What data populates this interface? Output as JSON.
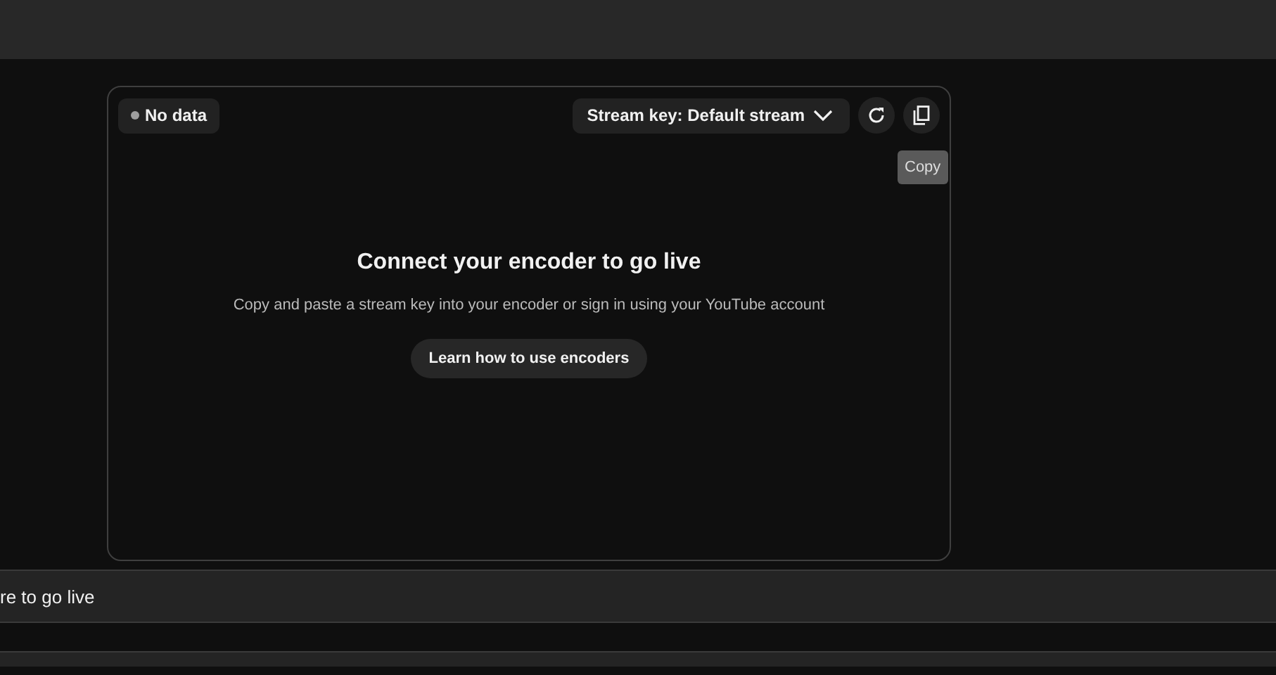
{
  "status_chip": {
    "label": "No data",
    "color": "#9e9e9e"
  },
  "stream_key_dropdown": {
    "label": "Stream key: Default stream"
  },
  "tooltip": {
    "text": "Copy"
  },
  "empty_state": {
    "title": "Connect your encoder to go live",
    "description": "Copy and paste a stream key into your encoder or sign in using your YouTube account",
    "button": "Learn how to use encoders"
  },
  "bottom_row": {
    "text": "re to go live"
  }
}
